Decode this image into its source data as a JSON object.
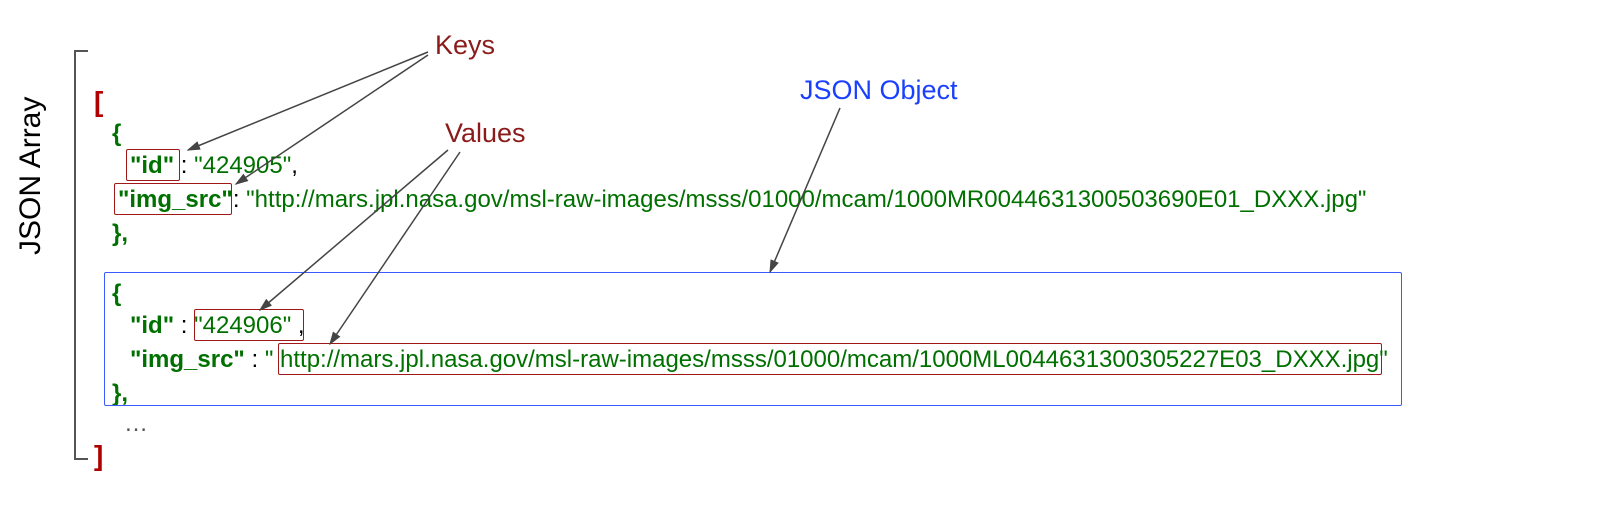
{
  "labels": {
    "side": "JSON Array",
    "keys": "Keys",
    "values": "Values",
    "object": "JSON Object"
  },
  "syntax": {
    "array_open": "[",
    "array_close": "]",
    "brace_open": "{",
    "brace_close_comma": "},",
    "colon": " : ",
    "ellipsis": "…"
  },
  "record1": {
    "key_id": "\"id\"",
    "val_id": "\"424905\"",
    "comma": ",",
    "key_src": "\"img_src\"",
    "src_colon": ": ",
    "val_src": "\"http://mars.jpl.nasa.gov/msl-raw-images/msss/01000/mcam/1000MR0044631300503690E01_DXXX.jpg\""
  },
  "record2": {
    "key_id": "\"id\"",
    "val_id": "\"424906\"",
    "comma": " ,",
    "key_src": "\"img_src\"",
    "src_colon": " : ",
    "val_src": "\" http://mars.jpl.nasa.gov/msl-raw-images/msss/01000/mcam/1000ML0044631300305227E03_DXXX.jpg\""
  }
}
